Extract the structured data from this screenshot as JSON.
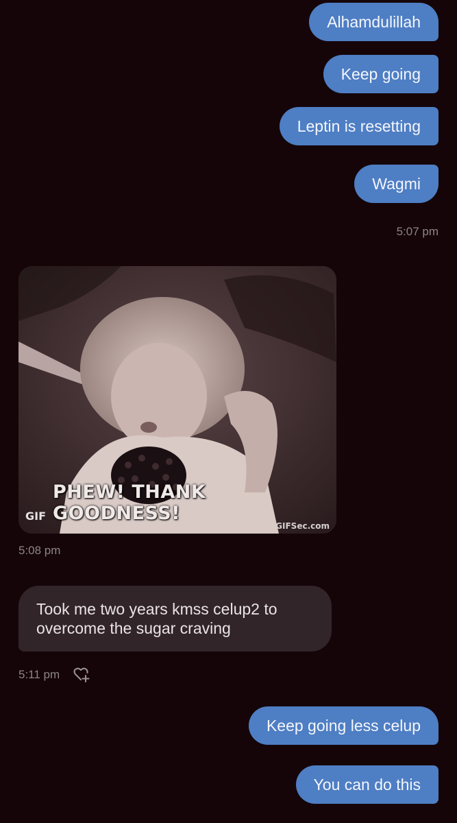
{
  "conversation": {
    "sent_group_1": [
      "Alhamdulillah",
      "Keep going",
      "Leptin is resetting",
      "Wagmi"
    ],
    "sent_group_1_time": "5:07 pm",
    "gif": {
      "badge": "GIF",
      "caption": "PHEW! THANK GOODNESS!",
      "watermark": "GIFSec.com"
    },
    "gif_time": "5:08 pm",
    "received_message": "Took me two years kmss celup2 to overcome the sugar craving",
    "received_time": "5:11 pm",
    "sent_group_2": [
      "Keep going less celup",
      "You can do this"
    ]
  },
  "icons": {
    "react": "heart-plus-icon"
  },
  "colors": {
    "background": "#150509",
    "sent_bubble": "#4e7ec4",
    "received_bubble": "#322529",
    "timestamp": "#8c8588"
  }
}
